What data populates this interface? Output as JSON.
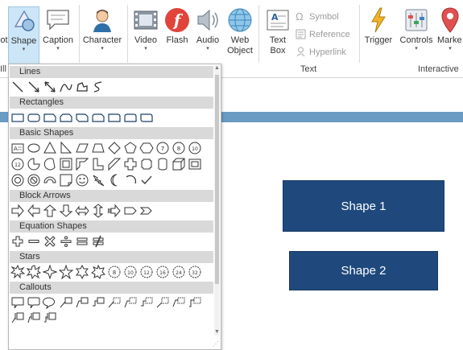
{
  "ribbon": {
    "buttons": {
      "partial_left": "ot",
      "shape": "Shape",
      "caption": "Caption",
      "character": "Character",
      "video": "Video",
      "flash": "Flash",
      "audio": "Audio",
      "web_object_line1": "Web",
      "web_object_line2": "Object",
      "text_box_line1": "Text",
      "text_box_line2": "Box",
      "trigger": "Trigger",
      "controls": "Controls",
      "markers": "Marke"
    },
    "small_buttons": {
      "symbol": "Symbol",
      "reference": "Reference",
      "hyperlink": "Hyperlink"
    },
    "groups": {
      "illustrations_partial": "Ill",
      "text": "Text",
      "interactive": "Interactive"
    },
    "colors": {
      "selected_button_bg": "#cde6f7",
      "flash_red": "#e0443a",
      "marker_red": "#e05050"
    }
  },
  "shape_gallery": {
    "categories": {
      "lines": "Lines",
      "rectangles": "Rectangles",
      "basic_shapes": "Basic Shapes",
      "block_arrows": "Block Arrows",
      "equation_shapes": "Equation Shapes",
      "stars": "Stars",
      "callouts": "Callouts"
    },
    "star_labels": [
      "4",
      "5",
      "6",
      "7",
      "8",
      "10",
      "12",
      "16",
      "24",
      "32"
    ],
    "basic_labels": [
      "7",
      "8",
      "10",
      "12"
    ]
  },
  "canvas": {
    "shape1": "Shape 1",
    "shape2": "Shape 2",
    "shape_color": "#1f497d",
    "strip_color": "#6a9bc3"
  }
}
